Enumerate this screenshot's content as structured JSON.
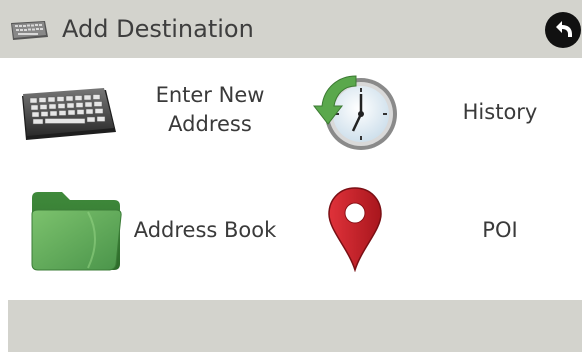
{
  "header": {
    "title": "Add Destination",
    "icon": "keyboard-icon",
    "back_icon": "back-arrow-icon"
  },
  "tiles": [
    {
      "label_line1": "Enter New",
      "label_line2": "Address",
      "icon": "keyboard-icon"
    },
    {
      "label": "History",
      "icon": "clock-history-icon"
    },
    {
      "label": "Address Book",
      "icon": "folder-icon"
    },
    {
      "label": "POI",
      "icon": "map-pin-icon"
    }
  ],
  "colors": {
    "header_bg": "#d3d3cd",
    "footer_bg": "#d3d3cd",
    "text": "#3a3a3a",
    "folder_green": "#4f9a4a",
    "pin_red": "#d0222a",
    "clock_arrow_green": "#5aa84c"
  }
}
